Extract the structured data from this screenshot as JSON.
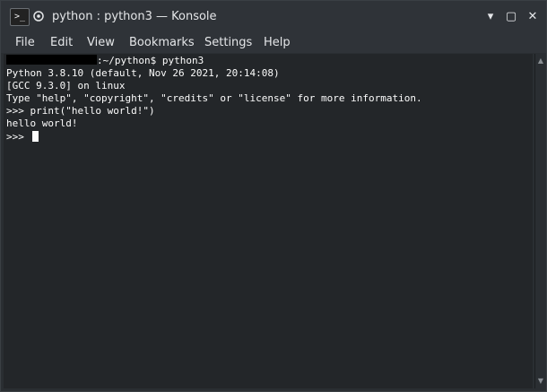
{
  "window": {
    "app_icon_glyph": ">_",
    "title": "python : python3 — Konsole",
    "minimize_glyph": "▾",
    "maximize_glyph": "▢",
    "close_glyph": "✕"
  },
  "menu": {
    "items": [
      "File",
      "Edit",
      "View",
      "Bookmarks",
      "Settings",
      "Help"
    ]
  },
  "terminal": {
    "prompt_suffix": ":~/python$ ",
    "command": "python3",
    "lines": [
      "Python 3.8.10 (default, Nov 26 2021, 20:14:08)",
      "[GCC 9.3.0] on linux",
      "Type \"help\", \"copyright\", \"credits\" or \"license\" for more information.",
      ">>> print(\"hello world!\")",
      "hello world!"
    ],
    "repl_prompt": ">>> "
  },
  "scrollbar": {
    "up_glyph": "▲",
    "down_glyph": "▼"
  },
  "colors": {
    "terminal_background": "#232629",
    "terminal_foreground": "#fcfcfc",
    "window_chrome": "#2f3338"
  }
}
